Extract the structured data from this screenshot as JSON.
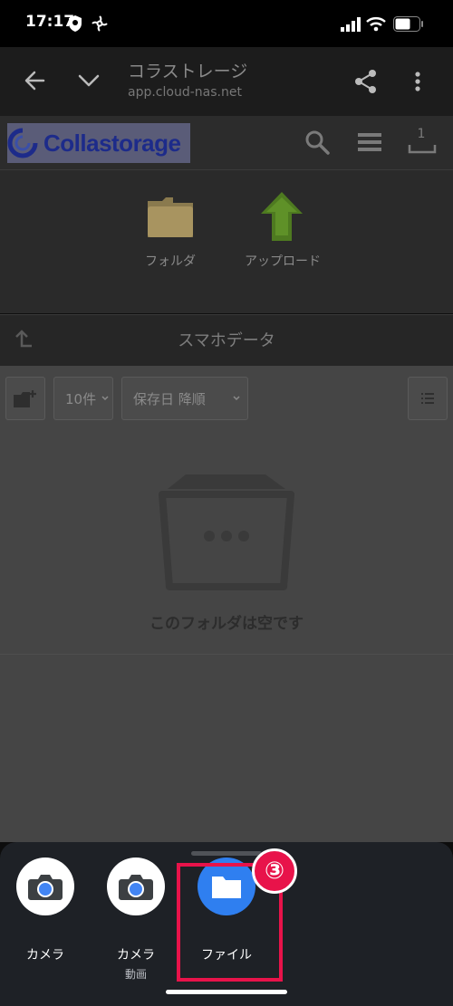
{
  "status_bar": {
    "time": "17:17"
  },
  "browser": {
    "title": "コラストレージ",
    "url": "app.cloud-nas.net"
  },
  "site": {
    "logo_text": "Collastorage",
    "upload_count": "1"
  },
  "actions": {
    "folder_label": "フォルダ",
    "upload_label": "アップロード"
  },
  "folder": {
    "name": "スマホデータ"
  },
  "toolbar": {
    "per_page": "10件",
    "sort": "保存日 降順"
  },
  "content": {
    "empty_message": "このフォルダは空です"
  },
  "sheet": {
    "apps": [
      {
        "label": "カメラ",
        "sub": ""
      },
      {
        "label": "カメラ",
        "sub": "動画"
      },
      {
        "label": "ファイル",
        "sub": ""
      }
    ],
    "step_badge": "③"
  },
  "colors": {
    "highlight": "#e8134a",
    "accent_blue": "#2f7ff0"
  }
}
